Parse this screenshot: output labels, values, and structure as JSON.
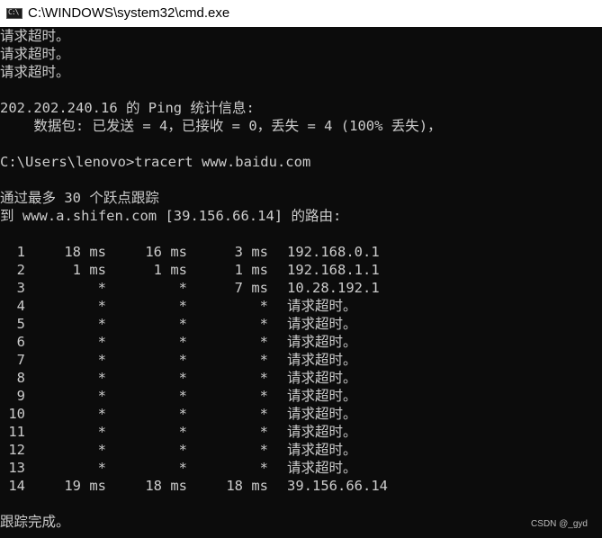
{
  "window": {
    "title": "C:\\WINDOWS\\system32\\cmd.exe",
    "icon": "cmd-console-icon"
  },
  "console": {
    "header_lines": [
      "请求超时。",
      "请求超时。",
      "请求超时。",
      "",
      "202.202.240.16 的 Ping 统计信息:",
      "    数据包: 已发送 = 4，已接收 = 0，丢失 = 4 (100% 丢失)，",
      "",
      "C:\\Users\\lenovo>tracert www.baidu.com",
      "",
      "通过最多 30 个跃点跟踪",
      "到 www.a.shifen.com [39.156.66.14] 的路由:",
      ""
    ],
    "hops": [
      {
        "hop": "1",
        "r1": "18 ms",
        "r2": "16 ms",
        "r3": "3 ms",
        "host": "192.168.0.1"
      },
      {
        "hop": "2",
        "r1": "1 ms",
        "r2": "1 ms",
        "r3": "1 ms",
        "host": "192.168.1.1"
      },
      {
        "hop": "3",
        "r1": "*",
        "r2": "*",
        "r3": "7 ms",
        "host": "10.28.192.1"
      },
      {
        "hop": "4",
        "r1": "*",
        "r2": "*",
        "r3": "*",
        "host": "请求超时。"
      },
      {
        "hop": "5",
        "r1": "*",
        "r2": "*",
        "r3": "*",
        "host": "请求超时。"
      },
      {
        "hop": "6",
        "r1": "*",
        "r2": "*",
        "r3": "*",
        "host": "请求超时。"
      },
      {
        "hop": "7",
        "r1": "*",
        "r2": "*",
        "r3": "*",
        "host": "请求超时。"
      },
      {
        "hop": "8",
        "r1": "*",
        "r2": "*",
        "r3": "*",
        "host": "请求超时。"
      },
      {
        "hop": "9",
        "r1": "*",
        "r2": "*",
        "r3": "*",
        "host": "请求超时。"
      },
      {
        "hop": "10",
        "r1": "*",
        "r2": "*",
        "r3": "*",
        "host": "请求超时。"
      },
      {
        "hop": "11",
        "r1": "*",
        "r2": "*",
        "r3": "*",
        "host": "请求超时。"
      },
      {
        "hop": "12",
        "r1": "*",
        "r2": "*",
        "r3": "*",
        "host": "请求超时。"
      },
      {
        "hop": "13",
        "r1": "*",
        "r2": "*",
        "r3": "*",
        "host": "请求超时。"
      },
      {
        "hop": "14",
        "r1": "19 ms",
        "r2": "18 ms",
        "r3": "18 ms",
        "host": "39.156.66.14"
      }
    ],
    "footer_lines": [
      "",
      "跟踪完成。"
    ]
  },
  "watermark": "CSDN @_gyd",
  "colors": {
    "background": "#0c0c0c",
    "text": "#cccccc",
    "titlebar": "#ffffff"
  }
}
